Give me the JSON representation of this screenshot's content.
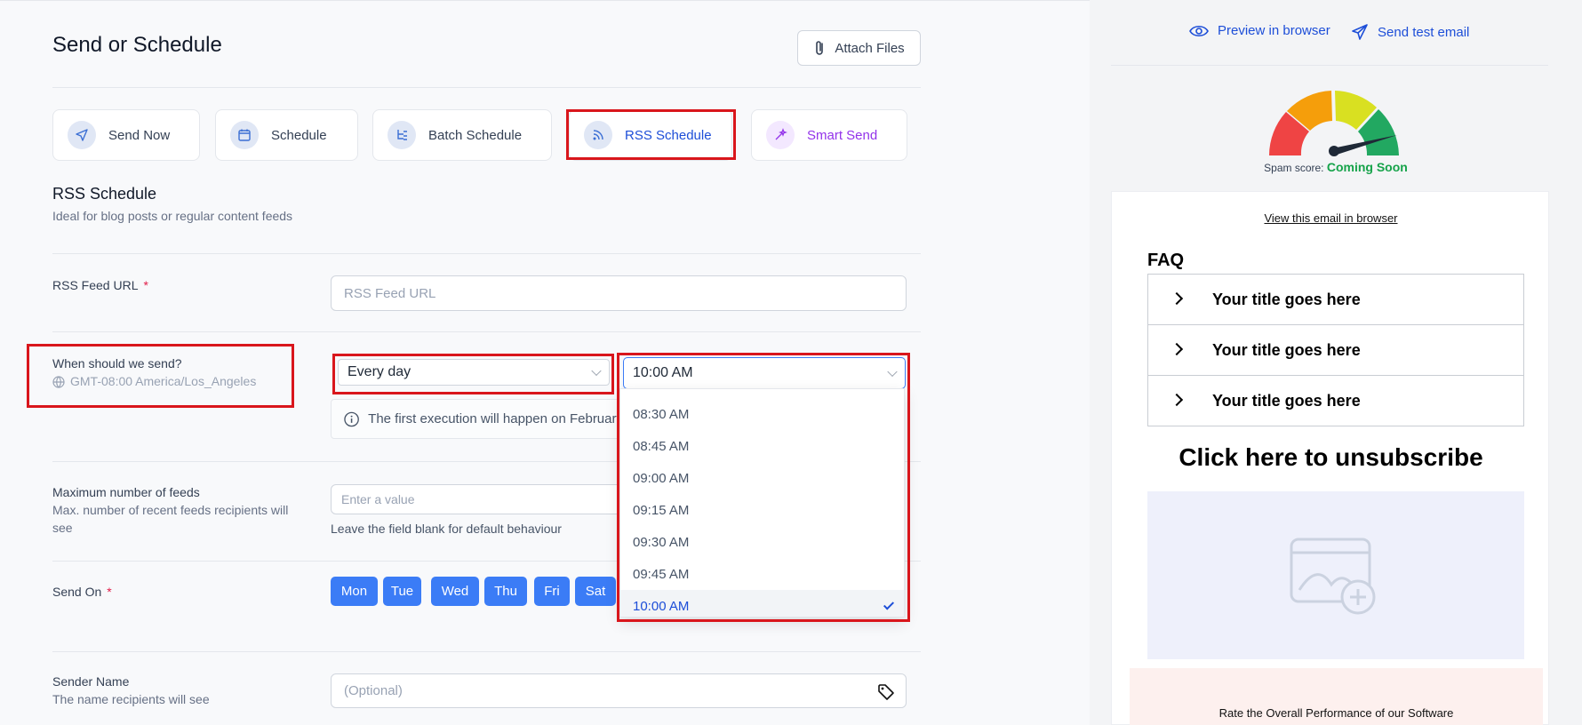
{
  "header": {
    "title": "Send or Schedule",
    "attach_label": "Attach Files"
  },
  "modes": [
    {
      "label": "Send Now",
      "icon": "send-icon"
    },
    {
      "label": "Schedule",
      "icon": "calendar-icon"
    },
    {
      "label": "Batch Schedule",
      "icon": "batch-icon"
    },
    {
      "label": "RSS Schedule",
      "icon": "rss-icon",
      "active": true
    },
    {
      "label": "Smart Send",
      "icon": "sparkle-icon"
    }
  ],
  "section": {
    "title": "RSS Schedule",
    "subtitle": "Ideal for blog posts or regular content feeds"
  },
  "rss_feed": {
    "label": "RSS Feed URL",
    "required_mark": "*",
    "placeholder": "RSS Feed URL"
  },
  "when": {
    "label": "When should we send?",
    "timezone": "GMT-08:00 America/Los_Angeles",
    "frequency": "Every day",
    "time": "10:00 AM",
    "info": "The first execution will happen on February"
  },
  "time_options": [
    "08:30 AM",
    "08:45 AM",
    "09:00 AM",
    "09:15 AM",
    "09:30 AM",
    "09:45 AM",
    "10:00 AM"
  ],
  "selected_time": "10:00 AM",
  "max_feeds": {
    "label": "Maximum number of feeds",
    "sublabel": "Max. number of recent feeds recipients will see",
    "placeholder": "Enter a value",
    "helper": "Leave the field blank for default behaviour"
  },
  "send_on": {
    "label": "Send On",
    "required_mark": "*",
    "days": [
      "Mon",
      "Tue",
      "Wed",
      "Thu",
      "Fri",
      "Sat"
    ]
  },
  "sender": {
    "label": "Sender Name",
    "sublabel": "The name recipients will see",
    "placeholder": "(Optional)"
  },
  "preview": {
    "preview_label": "Preview in browser",
    "test_label": "Send test email",
    "spam_label": "Spam score:",
    "spam_value": "Coming Soon",
    "view_link": "View this email in browser",
    "faq_title": "FAQ",
    "faq_items": [
      "Your title goes here",
      "Your title goes here",
      "Your title goes here"
    ],
    "unsubscribe": "Click here to unsubscribe",
    "rate_text": "Rate the Overall Performance of our Software"
  },
  "colors": {
    "accent": "#3b7cf6",
    "highlight": "#d9161c",
    "smart": "#9333ea",
    "spam_value": "#16a34a"
  }
}
